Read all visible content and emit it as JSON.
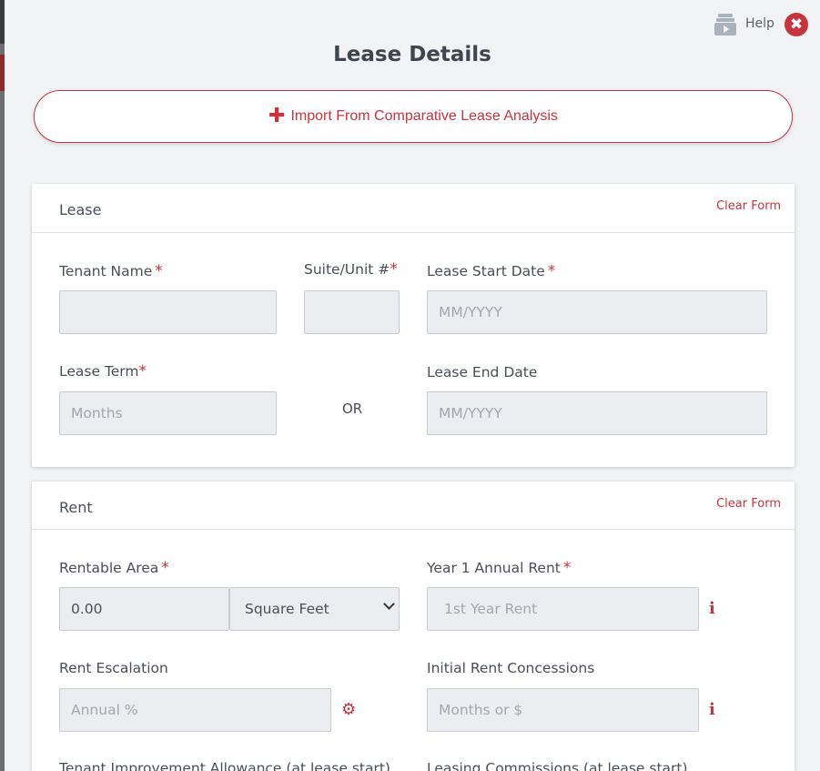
{
  "header": {
    "help_label": "Help",
    "close_symbol": "✖",
    "title": "Lease Details"
  },
  "import_button": {
    "icon": "plus-icon",
    "label": "Import From Comparative Lease Analysis"
  },
  "lease_card": {
    "title": "Lease",
    "clear_form": "Clear Form",
    "fields": {
      "tenant_name": {
        "label": "Tenant Name",
        "required": "*",
        "value": ""
      },
      "suite_unit": {
        "label": "Suite/Unit #",
        "required": "*",
        "value": ""
      },
      "lease_start": {
        "label": "Lease Start Date",
        "required": "*",
        "placeholder": "MM/YYYY"
      },
      "lease_term": {
        "label": "Lease Term",
        "required": "*",
        "placeholder": "Months"
      },
      "or_text": "OR",
      "lease_end": {
        "label": "Lease End Date",
        "placeholder": "MM/YYYY"
      }
    }
  },
  "rent_card": {
    "title": "Rent",
    "clear_form": "Clear Form",
    "fields": {
      "rentable_area": {
        "label": "Rentable Area",
        "required": "*",
        "value": "0.00"
      },
      "area_unit": {
        "selected": "Square Feet"
      },
      "year1_rent": {
        "label": "Year 1 Annual Rent",
        "required": "*",
        "placeholder": "1st Year Rent",
        "icon": "info-icon"
      },
      "rent_escalation": {
        "label": "Rent Escalation",
        "placeholder": "Annual %",
        "icon": "gear-icon"
      },
      "rent_concessions": {
        "label": "Initial Rent Concessions",
        "placeholder": "Months or $",
        "icon": "info-icon"
      },
      "ti_allowance": {
        "label": "Tenant Improvement Allowance (at lease start)"
      },
      "leasing_commissions": {
        "label": "Leasing Commissions (at lease start)"
      }
    }
  },
  "colors": {
    "accent": "#c8343c",
    "background": "#f2f3f5",
    "input_bg": "#ebedf0"
  }
}
